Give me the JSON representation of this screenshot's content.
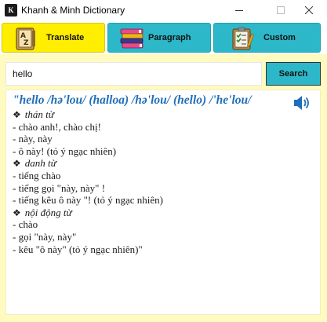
{
  "window": {
    "title": "Khanh & Minh Dictionary",
    "icon_text": "K"
  },
  "tabs": [
    {
      "label": "Translate",
      "icon": "dictionary-az-icon",
      "active": true
    },
    {
      "label": "Paragraph",
      "icon": "books-stack-icon",
      "active": false
    },
    {
      "label": "Custom",
      "icon": "checklist-clipboard-icon",
      "active": false
    }
  ],
  "search": {
    "value": "hello",
    "button_label": "Search"
  },
  "result": {
    "headword_quote": "\"",
    "headword": "hello /hə'lou/ (halloa) /hə'lou/ (hello) /'he'lou/",
    "speaker_icon": "speaker-icon",
    "entries": [
      {
        "kind": "pos",
        "bullet": "❖",
        "text": "thán từ"
      },
      {
        "kind": "def",
        "text": "- chào anh!, chào chị!"
      },
      {
        "kind": "def",
        "text": "- này, này"
      },
      {
        "kind": "def",
        "text": "- ô này! (tỏ ý ngạc nhiên)"
      },
      {
        "kind": "pos",
        "bullet": "❖",
        "text": "danh từ"
      },
      {
        "kind": "def",
        "text": "- tiếng chào"
      },
      {
        "kind": "def",
        "text": "- tiếng gọi \"này, này\" !"
      },
      {
        "kind": "def",
        "text": "- tiếng kêu ô này \"! (tỏ ý ngạc nhiên)"
      },
      {
        "kind": "pos",
        "bullet": "❖",
        "text": "nội động từ"
      },
      {
        "kind": "def",
        "text": "- chào"
      },
      {
        "kind": "def",
        "text": "- gọi \"này, này\""
      },
      {
        "kind": "def",
        "text": "- kêu \"ô này\" (tỏ ý ngạc nhiên)\""
      }
    ]
  },
  "colors": {
    "active_tab": "#ffee00",
    "inactive_tab": "#2cb8c8",
    "content_bg": "#fffbc0",
    "headword": "#1f6eb8"
  }
}
